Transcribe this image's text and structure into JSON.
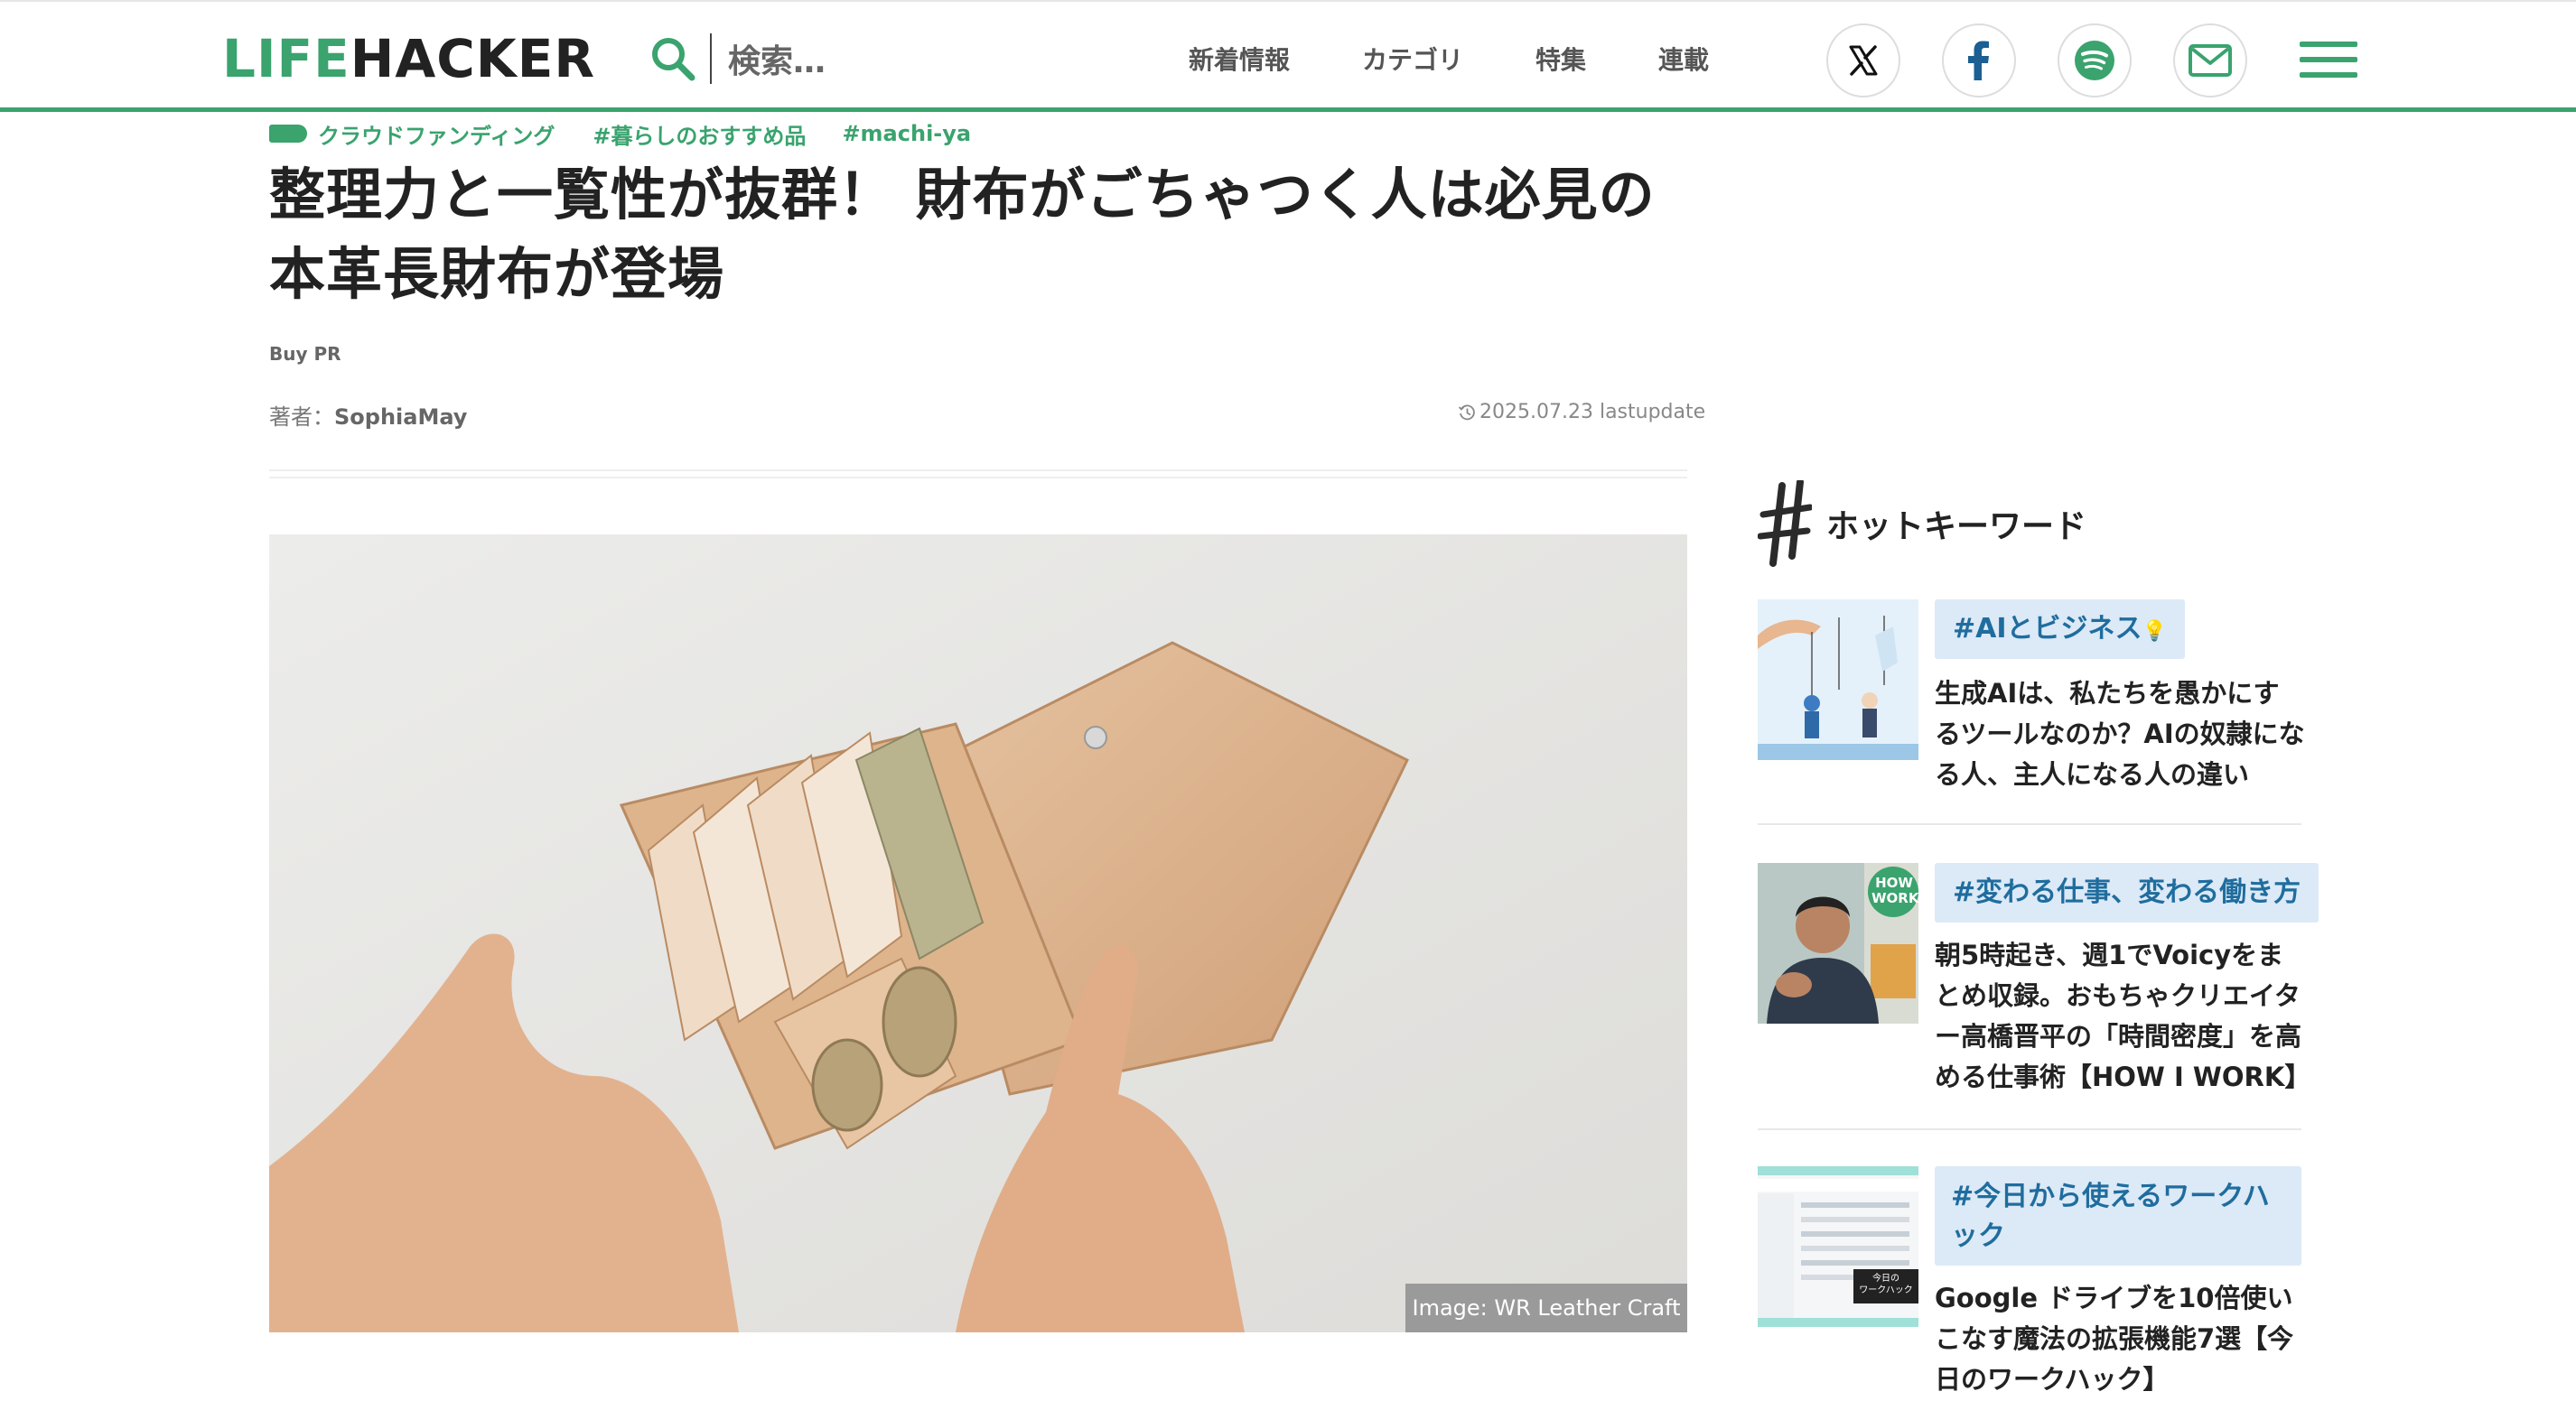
{
  "header": {
    "logo_left": "LIFE",
    "logo_right": "HACKER",
    "search_placeholder": "検索…",
    "nav": [
      "新着情報",
      "カテゴリ",
      "特集",
      "連載"
    ],
    "social": [
      "x-icon",
      "facebook-icon",
      "spotify-icon",
      "mail-icon"
    ],
    "brand_color": "#3aa36e"
  },
  "article": {
    "category": "クラウドファンディング",
    "tags": [
      "#暮らしのおすすめ品",
      "#machi-ya"
    ],
    "title_line1": "整理力と一覧性が抜群！ 財布がごちゃつく人は必見の",
    "title_line2": "本革長財布が登場",
    "pr_label": "Buy PR",
    "author_label": "著者：",
    "author_name": "SophiaMay",
    "updated": "2025.07.23 lastupdate",
    "image_caption": "Image: WR Leather Craft"
  },
  "sidebar": {
    "heading": "ホットキーワード",
    "cards": [
      {
        "keyword": "#AIとビジネス",
        "keyword_suffix": "💡",
        "text": "生成AIは、私たちを愚かにするツールなのか？AIの奴隷になる人、主人になる人の違い"
      },
      {
        "keyword": "#変わる仕事、変わる働き方",
        "thumb_badge_top": "HOW",
        "thumb_badge_bottom": "WORK",
        "text": "朝5時起き、週1でVoicyをまとめ収録。おもちゃクリエイター高橋晋平の「時間密度」を高める仕事術【HOW I WORK】"
      },
      {
        "keyword": "#今日から使えるワークハック",
        "thumb_badge_top": "今日の",
        "thumb_badge_bottom": "ワークハック",
        "text": "Google ドライブを10倍使いこなす魔法の拡張機能7選【今日のワークハック】"
      }
    ]
  }
}
